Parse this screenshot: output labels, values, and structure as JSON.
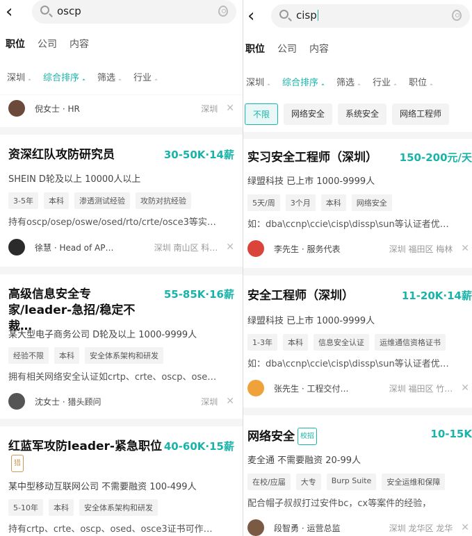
{
  "left": {
    "search": {
      "query": "oscp"
    },
    "tabs": [
      "职位",
      "公司",
      "内容"
    ],
    "filters": [
      "深圳",
      "综合排序",
      "筛选",
      "行业"
    ],
    "hr": {
      "name": "倪女士 · HR",
      "city": "深圳"
    },
    "cards": [
      {
        "title": "资深红队攻防研究员",
        "salary": "30-50K·14薪",
        "company": "SHEIN  D轮及以上  10000人以上",
        "tags": [
          "3-5年",
          "本科",
          "渗透测试经验",
          "攻防对抗经验"
        ],
        "desc": "持有oscp/osep/oswe/osed/rto/crte/osce3等实…",
        "recruiter": "徐慧 · Head of AP…",
        "location": "深圳  南山区  科…"
      },
      {
        "title": "高级信息安全专家/leader-急招/稳定不裁…",
        "salary": "55-85K·16薪",
        "company": "某大型电子商务公司  D轮及以上  1000-9999人",
        "tags": [
          "经验不限",
          "本科",
          "安全体系架构和研发"
        ],
        "desc": "拥有相关网络安全认证如crtp、crte、oscp、ose…",
        "recruiter": "沈女士 · 猎头顾问",
        "location": "深圳"
      },
      {
        "title": "红蓝军攻防leader-紧急职位",
        "badge": "猎",
        "salary": "40-60K·15薪",
        "company": "某中型移动互联网公司  不需要融资  100-499人",
        "tags": [
          "5-10年",
          "本科",
          "安全体系架构和研发"
        ],
        "desc": "持有crtp、crte、oscp、osed、osce3证书可作…"
      }
    ]
  },
  "right": {
    "search": {
      "query": "cisp"
    },
    "tabs": [
      "职位",
      "公司",
      "内容"
    ],
    "filters": [
      "深圳",
      "综合排序",
      "筛选",
      "行业",
      "职位"
    ],
    "chips": [
      "不限",
      "网络安全",
      "系统安全",
      "网络工程师"
    ],
    "cards": [
      {
        "title": "实习安全工程师（深圳）",
        "salary": "150-200元/天",
        "company": "绿盟科技  已上市  1000-9999人",
        "tags": [
          "5天/周",
          "3个月",
          "本科",
          "网络安全"
        ],
        "desc": "如：dba\\ccnp\\ccie\\cisp\\dissp\\sun等认证者优…",
        "recruiter": "李先生 · 服务代表",
        "location": "深圳  福田区  梅林"
      },
      {
        "title": "安全工程师（深圳）",
        "salary": "11-20K·14薪",
        "company": "绿盟科技  已上市  1000-9999人",
        "tags": [
          "1-3年",
          "本科",
          "信息安全认证",
          "运维通信资格证书"
        ],
        "desc": "如：dba\\ccnp\\ccie\\cisp\\dissp\\sun等认证者优…",
        "recruiter": "张先生 · 工程交付…",
        "location": "深圳  福田区  竹…"
      },
      {
        "title": "网络安全",
        "badge": "校招",
        "salary": "10-15K",
        "company": "麦全通  不需要融资  20-99人",
        "tags": [
          "在校/应届",
          "大专",
          "Burp Suite",
          "安全运维和保障"
        ],
        "desc": "配合帽子叔叔打过安件bc，cx等案件的经验，",
        "recruiter": "段智勇 · 运营总监",
        "location": "深圳  龙华区  龙华"
      }
    ]
  },
  "colors": {
    "accent": "#18b4a9",
    "text": "#222222",
    "muted": "#999999",
    "tag_bg": "#f3f3f3"
  }
}
